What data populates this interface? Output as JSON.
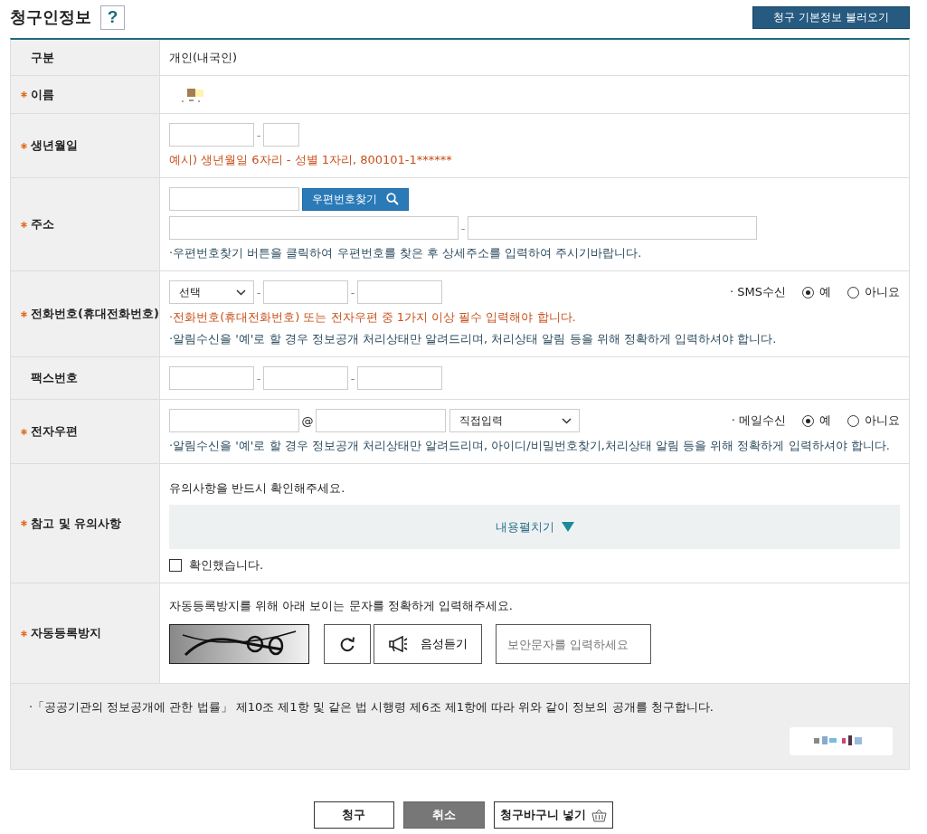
{
  "title": "청구인정보",
  "help_button": "?",
  "load_button": "청구 기본정보 불러오기",
  "rows": [
    {
      "kind": "text",
      "label": "구분",
      "required": false,
      "value": "개인(내국인)"
    },
    {
      "kind": "redacted",
      "label": "이름",
      "required": true
    },
    {
      "kind": "birth",
      "label": "생년월일",
      "required": true,
      "separator": "-",
      "notes": [
        {
          "text": "예시) 생년월일 6자리 - 성별 1자리, 800101-1******",
          "warning": true
        }
      ]
    },
    {
      "kind": "address",
      "label": "주소",
      "required": true,
      "separator": "-",
      "search_button": "우편번호찾기",
      "notes": [
        {
          "text": "·우편번호찾기 버튼을 클릭하여 우편번호를 찾은 후 상세주소를 입력하여 주시기바랍니다.",
          "warning": false
        }
      ]
    },
    {
      "kind": "phone",
      "label": "전화번호(휴대전화번호)",
      "required": true,
      "separator": "-",
      "select": "선택",
      "consent": {
        "label": "· SMS수신",
        "options": [
          {
            "label": "예",
            "selected": true
          },
          {
            "label": "아니요",
            "selected": false
          }
        ]
      },
      "notes": [
        {
          "text": "·전화번호(휴대전화번호) 또는 전자우편 중 1가지 이상 필수 입력해야 합니다.",
          "warning": true
        },
        {
          "text": "·알림수신을 '예'로 할 경우 정보공개 처리상태만 알려드리며, 처리상태 알림 등을 위해 정확하게 입력하셔야 합니다.",
          "warning": false
        }
      ]
    },
    {
      "kind": "fax",
      "label": "팩스번호",
      "required": false,
      "separator": "-"
    },
    {
      "kind": "email",
      "label": "전자우편",
      "required": true,
      "at": "@",
      "select": "직접입력",
      "consent": {
        "label": "· 메일수신",
        "options": [
          {
            "label": "예",
            "selected": true
          },
          {
            "label": "아니요",
            "selected": false
          }
        ]
      },
      "notes": [
        {
          "text": "·알림수신을 '예'로 할 경우 정보공개 처리상태만 알려드리며, 아이디/비밀번호찾기,처리상태 알림 등을 위해 정확하게 입력하셔야 합니다.",
          "warning": false
        }
      ]
    },
    {
      "kind": "notice",
      "label": "참고 및 유의사항",
      "required": true,
      "intro": "유의사항을 반드시 확인해주세요.",
      "expand_button": "내용펼치기",
      "expanded": false,
      "checkbox": {
        "label": "확인했습니다.",
        "checked": false
      }
    },
    {
      "kind": "captcha",
      "label": "자동등록방지",
      "required": true,
      "intro": "자동등록방지를 위해 아래 보이는 문자를 정확하게 입력해주세요.",
      "audio_button": "음성듣기",
      "placeholder": "보안문자를 입력하세요"
    }
  ],
  "declaration": "·「공공기관의 정보공개에 관한 법률」 제10조 제1항 및 같은 법 시행령 제6조 제1항에 따라 위와 같이 정보의 공개를 청구합니다.",
  "buttons": [
    {
      "label": "청구",
      "kind": "submit"
    },
    {
      "label": "취소",
      "kind": "cancel"
    },
    {
      "label": "청구바구니 넣기",
      "kind": "basket"
    }
  ]
}
